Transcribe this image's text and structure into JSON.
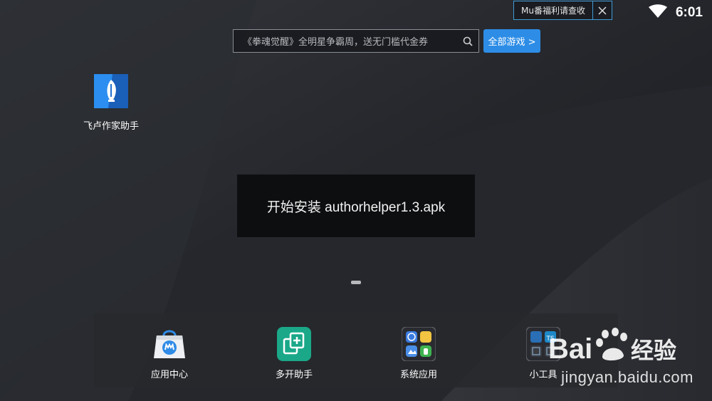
{
  "notification": {
    "text": "Mu番福利请查收"
  },
  "status_bar": {
    "time": "6:01"
  },
  "search": {
    "placeholder": "《拳魂觉醒》全明星争霸周，送无门槛代金券"
  },
  "all_games_button": {
    "label": "全部游戏 >"
  },
  "desktop_apps": [
    {
      "label": "飞卢作家助手",
      "icon": "feather-pen-icon"
    }
  ],
  "toast": {
    "message": "开始安装 authorhelper1.3.apk"
  },
  "dock": {
    "items": [
      {
        "label": "应用中心",
        "icon": "app-store-bag-icon"
      },
      {
        "label": "多开助手",
        "icon": "multi-open-icon"
      },
      {
        "label": "系统应用",
        "icon": "system-apps-icon"
      },
      {
        "label": "小工具",
        "icon": "tools-icon"
      }
    ]
  },
  "watermark": {
    "brand": "Bai经验",
    "url": "jingyan.baidu.com"
  },
  "colors": {
    "accent": "#2d8de6",
    "notification_border": "#3f9bd6",
    "background": "#1f2024"
  }
}
